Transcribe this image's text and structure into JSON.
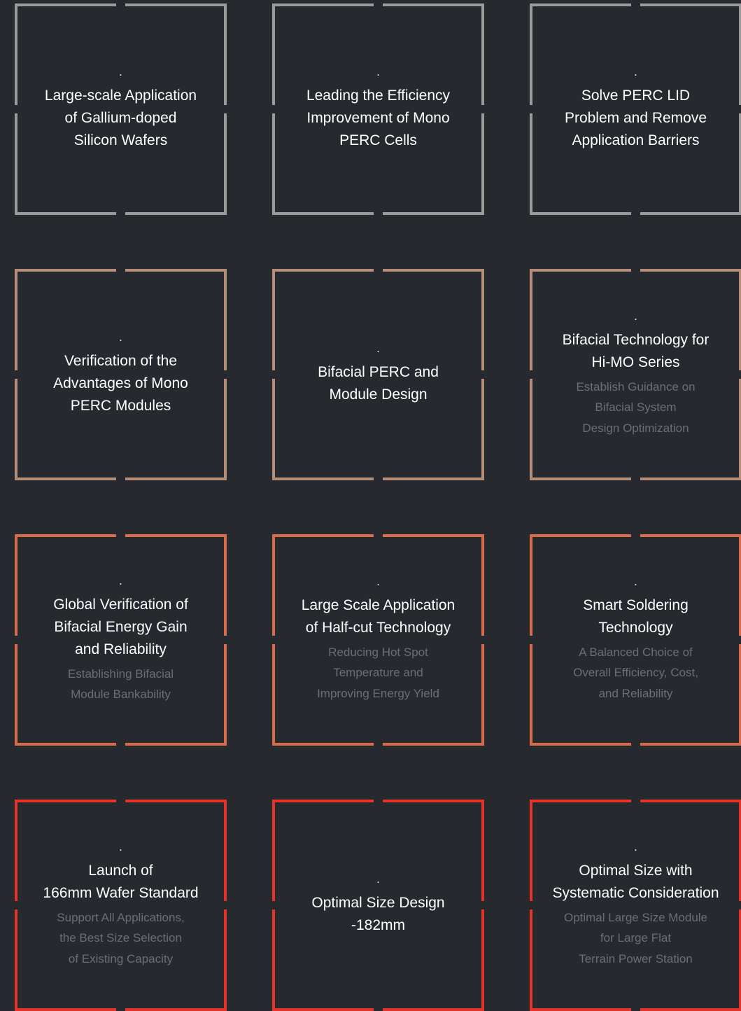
{
  "cards": [
    {
      "dot": ".",
      "title": "Large-scale Application\nof Gallium-doped\nSilicon Wafers",
      "subtitle": "",
      "color": "#9a9a9a"
    },
    {
      "dot": ".",
      "title": "Leading the Efficiency\nImprovement of Mono\nPERC Cells",
      "subtitle": "",
      "color": "#9a9a9a"
    },
    {
      "dot": ".",
      "title": "Solve PERC LID\nProblem and Remove\nApplication Barriers",
      "subtitle": "",
      "color": "#9a9a9a"
    },
    {
      "dot": ".",
      "title": "Verification of the\nAdvantages of Mono\nPERC Modules",
      "subtitle": "",
      "color": "#b48c78"
    },
    {
      "dot": ".",
      "title": "Bifacial PERC and\nModule Design",
      "subtitle": "",
      "color": "#b48c78"
    },
    {
      "dot": ".",
      "title": "Bifacial Technology for\nHi-MO Series",
      "subtitle": "Establish Guidance on\nBifacial System\nDesign Optimization",
      "color": "#b48c78"
    },
    {
      "dot": ".",
      "title": "Global Verification of\nBifacial Energy Gain\nand Reliability",
      "subtitle": "Establishing Bifacial\nModule Bankability",
      "color": "#d96a4c"
    },
    {
      "dot": ".",
      "title": "Large Scale Application\nof Half-cut Technology",
      "subtitle": "Reducing Hot Spot\nTemperature and\nImproving Energy Yield",
      "color": "#d96a4c"
    },
    {
      "dot": ".",
      "title": "Smart Soldering\nTechnology",
      "subtitle": "A Balanced Choice of\nOverall Efficiency, Cost,\nand Reliability",
      "color": "#d96a4c"
    },
    {
      "dot": ".",
      "title": "Launch of\n166mm Wafer Standard",
      "subtitle": "Support All Applications,\nthe Best Size Selection\nof Existing Capacity",
      "color": "#e2322a"
    },
    {
      "dot": ".",
      "title": "Optimal Size Design\n-182mm",
      "subtitle": "",
      "color": "#e2322a"
    },
    {
      "dot": ".",
      "title": "Optimal Size with\nSystematic Consideration",
      "subtitle": "Optimal Large Size Module\nfor Large Flat\nTerrain Power Station",
      "color": "#e2322a"
    }
  ]
}
